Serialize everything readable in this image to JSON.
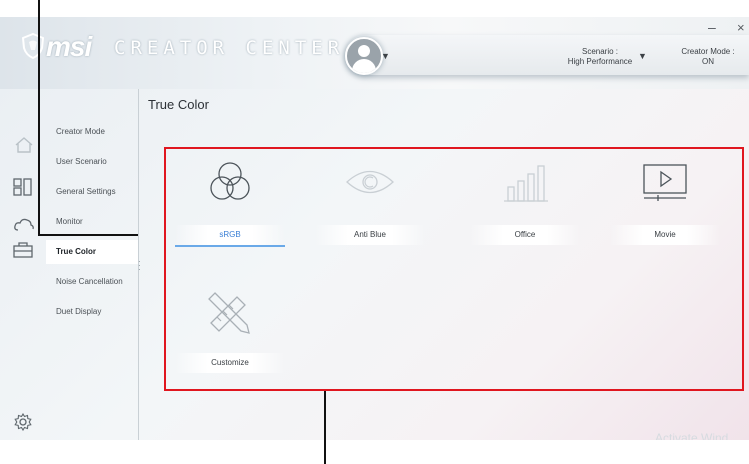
{
  "header": {
    "brand": "msi",
    "product": "CREATOR CENTER",
    "scenario_label": "Scenario :",
    "scenario_value": "High Performance",
    "creator_mode_label": "Creator Mode :",
    "creator_mode_value": "ON",
    "minimize": "–",
    "close": "×"
  },
  "rail_icons": [
    "home-icon",
    "grid-icon",
    "cloud-icon",
    "toolbox-icon",
    "settings-icon"
  ],
  "menu": {
    "items": [
      {
        "label": "Creator Mode",
        "active": false
      },
      {
        "label": "User Scenario",
        "active": false
      },
      {
        "label": "General Settings",
        "active": false
      },
      {
        "label": "Monitor",
        "active": false
      },
      {
        "label": "True Color",
        "active": true
      },
      {
        "label": "Noise Cancellation",
        "active": false
      },
      {
        "label": "Duet Display",
        "active": false
      }
    ]
  },
  "main": {
    "title": "True Color",
    "modes": [
      {
        "label": "sRGB",
        "icon": "color-circles-icon",
        "selected": true
      },
      {
        "label": "Anti Blue",
        "icon": "eye-icon",
        "selected": false
      },
      {
        "label": "Office",
        "icon": "bar-chart-icon",
        "selected": false
      },
      {
        "label": "Movie",
        "icon": "play-screen-icon",
        "selected": false
      },
      {
        "label": "Customize",
        "icon": "ruler-pencil-icon",
        "selected": false
      }
    ]
  },
  "watermark": "Activate Wind",
  "colors": {
    "highlight_box": "#e0161f",
    "selected_label": "#3a7fd5",
    "annotation_line": "#111111"
  }
}
